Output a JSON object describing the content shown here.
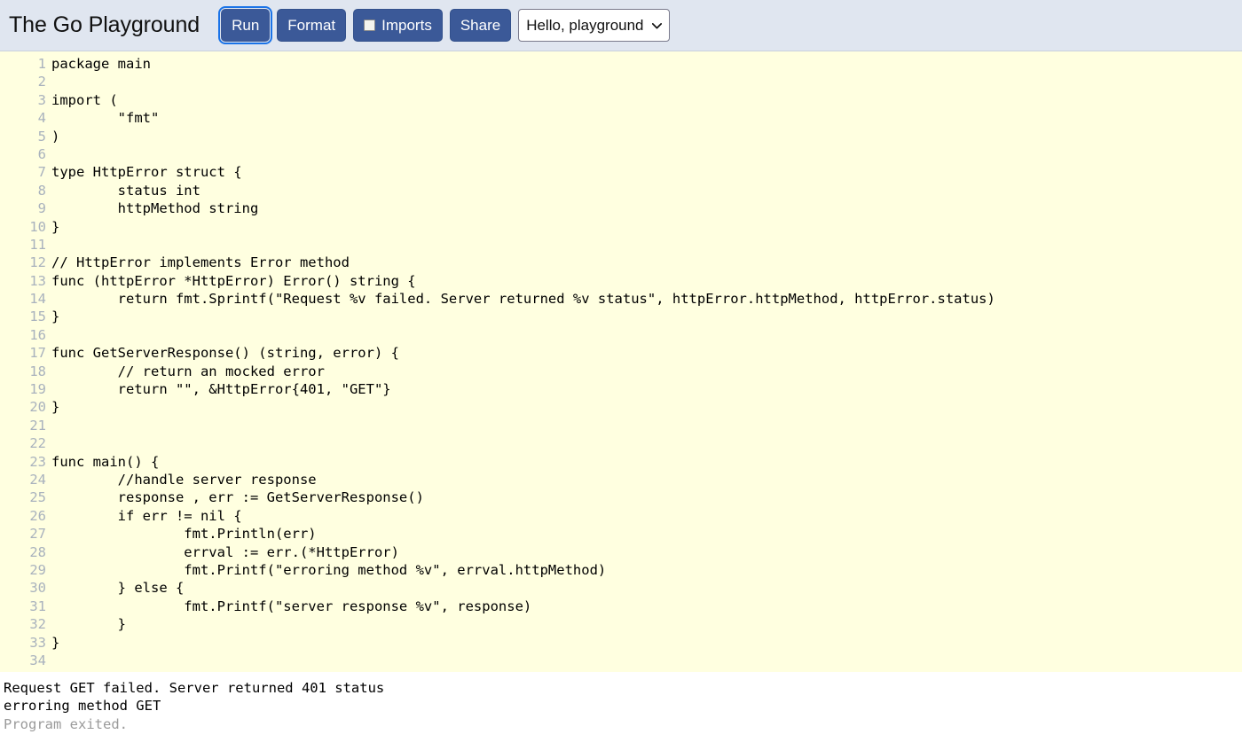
{
  "header": {
    "brand": "The Go Playground",
    "buttons": [
      {
        "name": "run",
        "label": "Run",
        "focused": true,
        "checkbox": false
      },
      {
        "name": "format",
        "label": "Format",
        "focused": false,
        "checkbox": false
      },
      {
        "name": "imports",
        "label": "Imports",
        "focused": false,
        "checkbox": true
      },
      {
        "name": "share",
        "label": "Share",
        "focused": false,
        "checkbox": false
      }
    ],
    "example_select": {
      "selected": "Hello, playground",
      "caret": "⌄",
      "options": [
        "Hello, playground"
      ]
    },
    "colors": {
      "bar_bg": "#E0E6F0",
      "button_bg": "#3b5998",
      "focus_ring": "#1a73e8"
    }
  },
  "editor": {
    "background": "#FFFFE0",
    "gutter_color": "#a9b2bd",
    "text_color": "#000000",
    "lines": [
      {
        "n": "1",
        "text": "package main"
      },
      {
        "n": "2",
        "text": ""
      },
      {
        "n": "3",
        "text": "import ("
      },
      {
        "n": "4",
        "text": "        \"fmt\""
      },
      {
        "n": "5",
        "text": ")"
      },
      {
        "n": "6",
        "text": ""
      },
      {
        "n": "7",
        "text": "type HttpError struct {"
      },
      {
        "n": "8",
        "text": "        status int"
      },
      {
        "n": "9",
        "text": "        httpMethod string"
      },
      {
        "n": "10",
        "text": "}"
      },
      {
        "n": "11",
        "text": ""
      },
      {
        "n": "12",
        "text": "// HttpError implements Error method"
      },
      {
        "n": "13",
        "text": "func (httpError *HttpError) Error() string {"
      },
      {
        "n": "14",
        "text": "        return fmt.Sprintf(\"Request %v failed. Server returned %v status\", httpError.httpMethod, httpError.status)"
      },
      {
        "n": "15",
        "text": "}"
      },
      {
        "n": "16",
        "text": ""
      },
      {
        "n": "17",
        "text": "func GetServerResponse() (string, error) {"
      },
      {
        "n": "18",
        "text": "        // return an mocked error"
      },
      {
        "n": "19",
        "text": "        return \"\", &HttpError{401, \"GET\"}"
      },
      {
        "n": "20",
        "text": "}"
      },
      {
        "n": "21",
        "text": ""
      },
      {
        "n": "22",
        "text": ""
      },
      {
        "n": "23",
        "text": "func main() {"
      },
      {
        "n": "24",
        "text": "        //handle server response"
      },
      {
        "n": "25",
        "text": "        response , err := GetServerResponse()"
      },
      {
        "n": "26",
        "text": "        if err != nil {"
      },
      {
        "n": "27",
        "text": "                fmt.Println(err)"
      },
      {
        "n": "28",
        "text": "                errval := err.(*HttpError)"
      },
      {
        "n": "29",
        "text": "                fmt.Printf(\"erroring method %v\", errval.httpMethod)"
      },
      {
        "n": "30",
        "text": "        } else {"
      },
      {
        "n": "31",
        "text": "                fmt.Printf(\"server response %v\", response)"
      },
      {
        "n": "32",
        "text": "        }"
      },
      {
        "n": "33",
        "text": "}"
      },
      {
        "n": "34",
        "text": ""
      }
    ]
  },
  "output": {
    "background": "#ffffff",
    "lines": [
      {
        "text": "Request GET failed. Server returned 401 status",
        "kind": "stdout"
      },
      {
        "text": "erroring method GET",
        "kind": "stdout"
      },
      {
        "text": "Program exited.",
        "kind": "system"
      }
    ]
  }
}
